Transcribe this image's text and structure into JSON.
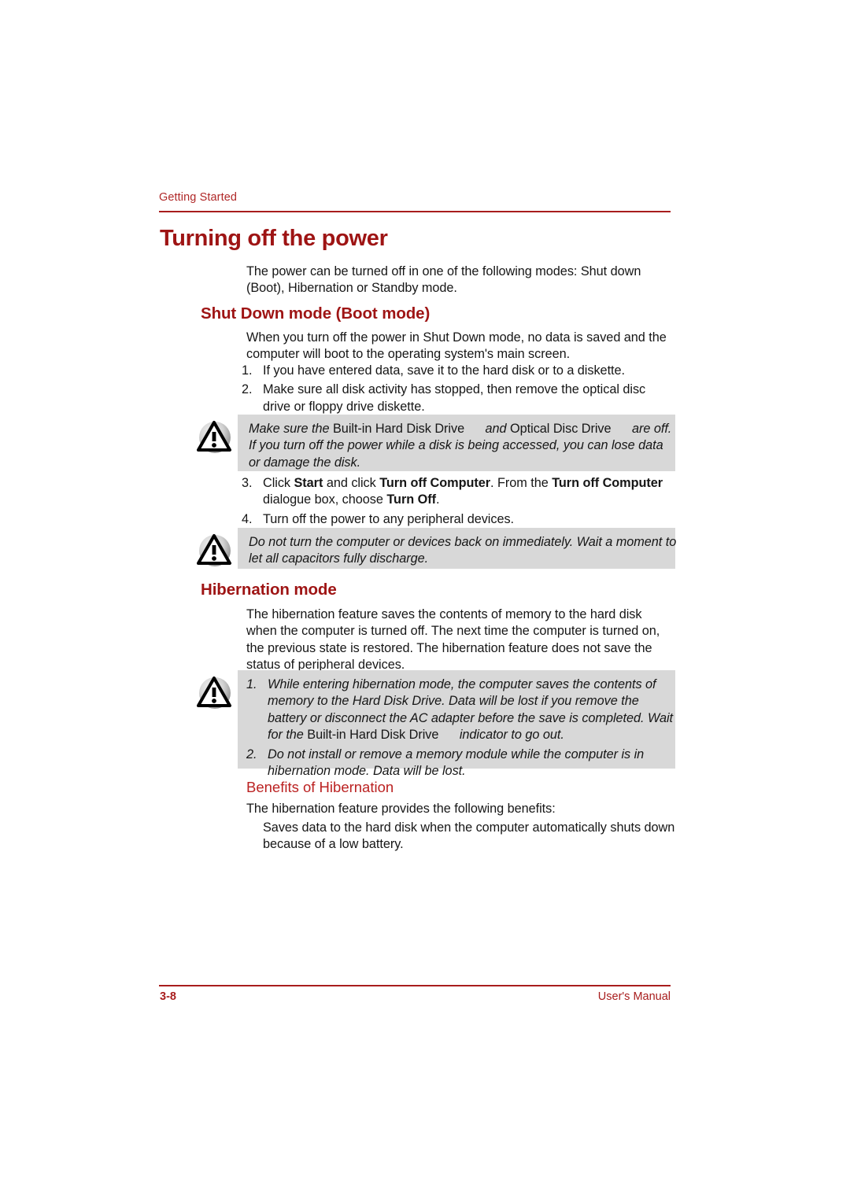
{
  "header": {
    "running_head": "Getting Started",
    "page_title": "Turning off the power"
  },
  "intro": {
    "paragraph": "The power can be turned off in one of the following modes: Shut down (Boot), Hibernation or Standby mode."
  },
  "shutdown_section": {
    "heading": "Shut Down mode (Boot mode)",
    "intro": "When you turn off the power in Shut Down mode, no data is saved and the computer will boot to the operating system's main screen.",
    "steps": [
      {
        "num": "1.",
        "text": "If you have entered data, save it to the hard disk or to a diskette."
      },
      {
        "num": "2.",
        "text": "Make sure all disk activity has stopped, then remove the optical disc drive or floppy drive diskette."
      }
    ],
    "step3": {
      "num": "3.",
      "part1": "Click ",
      "bold1": "Start",
      "part2": " and click ",
      "bold2": "Turn off Computer",
      "part3": ". From the ",
      "bold3": "Turn off Computer",
      "part4": " dialogue box, choose ",
      "bold4": "Turn Off",
      "part5": "."
    },
    "step4": {
      "num": "4.",
      "text": "Turn off the power to any peripheral devices."
    }
  },
  "caution1": {
    "icon": "warning-triangle-icon",
    "part1": "Make sure the ",
    "upright1": "Built-in Hard Disk Drive",
    "part2": " and ",
    "upright2": "Optical Disc Drive",
    "part3": " are off. If you turn off the power while a disk is being accessed, you can lose data or damage the disk."
  },
  "caution2": {
    "icon": "warning-triangle-icon",
    "text": "Do not turn the computer or devices back on immediately. Wait a moment to let all capacitors fully discharge."
  },
  "hibernation_section": {
    "heading": "Hibernation mode",
    "paragraph": "The hibernation feature saves the contents of memory to the hard disk when the computer is turned off. The next time the computer is turned on, the previous state is restored. The hibernation feature does not save the status of peripheral devices."
  },
  "caution3": {
    "icon": "warning-triangle-icon",
    "item1": {
      "num": "1.",
      "part1": "While entering hibernation mode, the computer saves the contents of memory to the Hard Disk Drive. Data will be lost if you remove the battery or disconnect the AC adapter before the save is completed. Wait for the ",
      "upright1": "Built-in Hard Disk Drive",
      "part2": " indicator to go out."
    },
    "item2": {
      "num": "2.",
      "text": "Do not install or remove a memory module while the computer is in hibernation mode. Data will be lost."
    }
  },
  "benefits_section": {
    "heading": "Benefits of Hibernation",
    "paragraph": "The hibernation feature provides the following benefits:",
    "bullet": "Saves data to the hard disk when the computer automatically shuts down because of a low battery."
  },
  "footer": {
    "page_number": "3-8",
    "manual_label": "User's Manual"
  },
  "colors": {
    "heading_red": "#9e1414",
    "accent_red": "#a81d1d",
    "subheading_red": "#bb2222",
    "caution_bg": "#d8d8d8"
  }
}
